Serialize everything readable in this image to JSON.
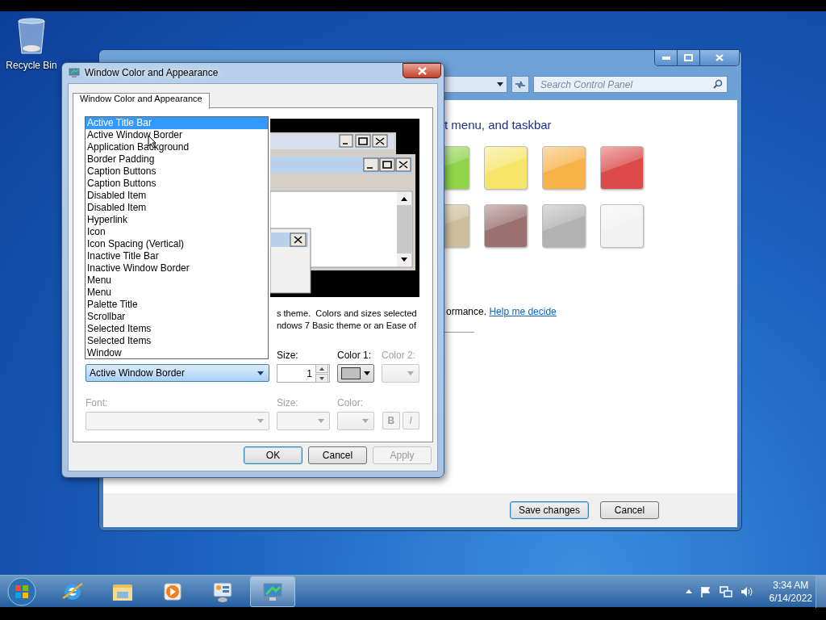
{
  "desktop": {
    "icons": [
      {
        "label": "Recycle Bin"
      }
    ]
  },
  "control_panel": {
    "search": {
      "placeholder": "Search Control Panel"
    },
    "heading": "t menu, and taskbar",
    "swatches": [
      {
        "color": "#8fd44a"
      },
      {
        "color": "#f7e46a"
      },
      {
        "color": "#f8b24a"
      },
      {
        "color": "#dc4a4a"
      },
      {
        "color": "#cdbf9c"
      },
      {
        "color": "#9a7070"
      },
      {
        "color": "#b2b2b2"
      },
      {
        "color": "#f2f2f2"
      }
    ],
    "note": "ormance.",
    "link": "Help me decide",
    "buttons": [
      {
        "label": "Save changes",
        "default": true
      },
      {
        "label": "Cancel",
        "default": false
      }
    ]
  },
  "dialog": {
    "title": "Window Color and Appearance",
    "tabs": [
      {
        "label": "Window Color and Appearance",
        "selected": true
      }
    ],
    "item_list": [
      {
        "label": "Active Title Bar",
        "selected": true
      },
      {
        "label": "Active Window Border",
        "selected": false
      },
      {
        "label": "Application Background",
        "selected": false
      },
      {
        "label": "Border Padding",
        "selected": false
      },
      {
        "label": "Caption Buttons",
        "selected": false
      },
      {
        "label": "Caption Buttons",
        "selected": false
      },
      {
        "label": "Disabled Item",
        "selected": false
      },
      {
        "label": "Disabled Item",
        "selected": false
      },
      {
        "label": "Hyperlink",
        "selected": false
      },
      {
        "label": "Icon",
        "selected": false
      },
      {
        "label": "Icon Spacing (Vertical)",
        "selected": false
      },
      {
        "label": "Inactive Title Bar",
        "selected": false
      },
      {
        "label": "Inactive Window Border",
        "selected": false
      },
      {
        "label": "Menu",
        "selected": false
      },
      {
        "label": "Menu",
        "selected": false
      },
      {
        "label": "Palette Title",
        "selected": false
      },
      {
        "label": "Scrollbar",
        "selected": false
      },
      {
        "label": "Selected Items",
        "selected": false
      },
      {
        "label": "Selected Items",
        "selected": false
      },
      {
        "label": "Window",
        "selected": false
      }
    ],
    "description": [
      "s theme.  Colors and sizes selected",
      "ndows 7 Basic theme or an Ease of"
    ],
    "item_combo": {
      "value": "Active Window Border"
    },
    "item_fields": [
      {
        "label": "Size:",
        "kind": "spin",
        "value": "1",
        "disabled": false
      },
      {
        "label": "Color 1:",
        "kind": "color",
        "disabled": false
      },
      {
        "label": "Color 2:",
        "kind": "color",
        "disabled": true
      }
    ],
    "font_label": "Font:",
    "font_disabled": true,
    "font_fields": [
      {
        "label": "Size:",
        "kind": "combo",
        "disabled": true
      },
      {
        "label": "Color:",
        "kind": "color",
        "disabled": true
      }
    ],
    "style_buttons": [
      {
        "label": "B",
        "kind": "bold",
        "disabled": true
      },
      {
        "label": "I",
        "kind": "italic",
        "disabled": true
      }
    ],
    "buttons": [
      {
        "label": "OK",
        "disabled": false,
        "default": true
      },
      {
        "label": "Cancel",
        "disabled": false,
        "default": false
      },
      {
        "label": "Apply",
        "disabled": true,
        "default": false
      }
    ]
  },
  "taskbar": {
    "apps": [
      {
        "kind": "browser",
        "selected": false
      },
      {
        "kind": "folder",
        "selected": false
      },
      {
        "kind": "media",
        "selected": false
      },
      {
        "kind": "control",
        "selected": false
      },
      {
        "kind": "display",
        "selected": true
      }
    ],
    "clock": {
      "time": "3:34 AM",
      "date": "6/14/2022"
    }
  }
}
